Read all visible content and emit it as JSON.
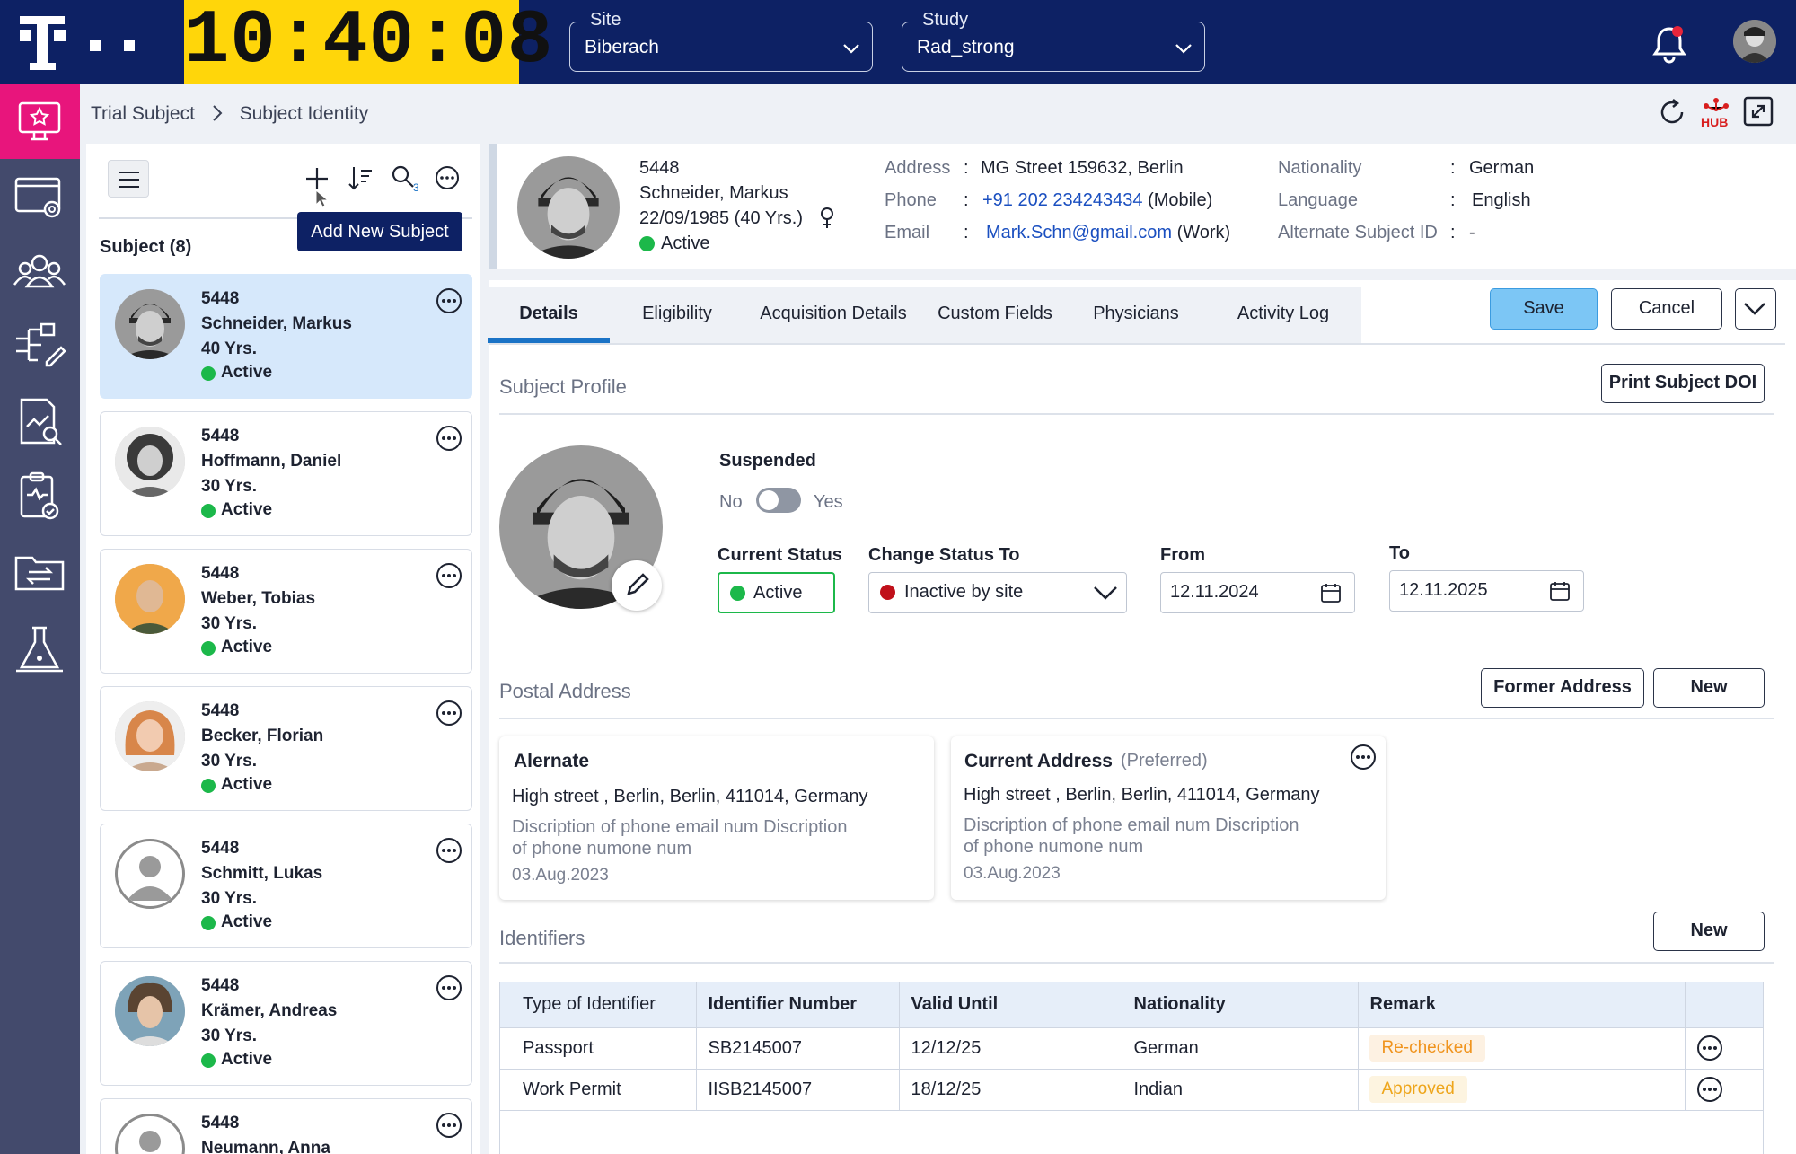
{
  "header": {
    "clock": "10:40:08",
    "site": {
      "label": "Site",
      "value": "Biberach"
    },
    "study": {
      "label": "Study",
      "value": "Rad_strong"
    }
  },
  "breadcrumb": [
    "Trial Subject",
    "Subject Identity"
  ],
  "toolbar": {
    "tooltip": "Add New Subject",
    "search_count": "3",
    "list_title": "Subject (8)"
  },
  "subjects": [
    {
      "id": "5448",
      "name": "Schneider, Markus",
      "age": "40 Yrs.",
      "status": "Active"
    },
    {
      "id": "5448",
      "name": "Hoffmann, Daniel",
      "age": "30 Yrs.",
      "status": "Active"
    },
    {
      "id": "5448",
      "name": "Weber, Tobias",
      "age": "30 Yrs.",
      "status": "Active"
    },
    {
      "id": "5448",
      "name": "Becker, Florian",
      "age": "30 Yrs.",
      "status": "Active"
    },
    {
      "id": "5448",
      "name": "Schmitt, Lukas",
      "age": "30 Yrs.",
      "status": "Active"
    },
    {
      "id": "5448",
      "name": "Krämer, Andreas",
      "age": "30 Yrs.",
      "status": "Active"
    },
    {
      "id": "5448",
      "name": "Neumann, Anna",
      "age": "",
      "status": ""
    }
  ],
  "profile": {
    "id": "5448",
    "name": "Schneider, Markus",
    "dob": "22/09/1985 (40 Yrs.)",
    "status": "Active",
    "address_label": "Address",
    "address": "MG Street 159632, Berlin",
    "phone_label": "Phone",
    "phone": "+91 202 234243434",
    "phone_type": "(Mobile)",
    "email_label": "Email",
    "email": "Mark.Schn@gmail.com",
    "email_type": "(Work)",
    "nationality_label": "Nationality",
    "nationality": "German",
    "language_label": "Language",
    "language": "English",
    "alt_id_label": "Alternate Subject ID",
    "alt_id": "-",
    "sep": ":"
  },
  "tabs": [
    "Details",
    "Eligibility",
    "Acquisition Details",
    "Custom Fields",
    "Physicians",
    "Activity Log"
  ],
  "actions": {
    "save": "Save",
    "cancel": "Cancel"
  },
  "subject_profile": {
    "title": "Subject Profile",
    "print": "Print Subject DOI",
    "suspended": "Suspended",
    "no": "No",
    "yes": "Yes",
    "current_status_label": "Current Status",
    "current_status": "Active",
    "change_status_label": "Change Status To",
    "change_status": "Inactive by site",
    "from_label": "From",
    "from": "12.11.2024",
    "to_label": "To",
    "to": "12.11.2025"
  },
  "postal": {
    "title": "Postal Address",
    "former": "Former Address",
    "new": "New",
    "alt": {
      "title": "Alernate",
      "line": "High street , Berlin, Berlin, 411014, Germany",
      "desc1": "Discription of phone email num Discription",
      "desc2": "of phone numone num",
      "date": "03.Aug.2023"
    },
    "cur": {
      "title": "Current Address",
      "pref": "(Preferred)",
      "line": "High street , Berlin, Berlin, 411014, Germany",
      "desc1": "Discription of phone email num Discription",
      "desc2": "of phone numone num",
      "date": "03.Aug.2023"
    }
  },
  "identifiers": {
    "title": "Identifiers",
    "new": "New",
    "headers": [
      "Type of Identifier",
      "Identifier Number",
      "Valid Until",
      "Nationality",
      "Remark"
    ],
    "rows": [
      {
        "type": "Passport",
        "number": "SB2145007",
        "valid": "12/12/25",
        "nationality": "German",
        "remark": "Re-checked"
      },
      {
        "type": "Work Permit",
        "number": "IISB2145007",
        "valid": "18/12/25",
        "nationality": "Indian",
        "remark": "Approved"
      }
    ]
  },
  "colors": {
    "header": "#0d2164",
    "clock": "#ffd60a",
    "accent": "#e8157c",
    "active": "#1cb84a",
    "tab_underline": "#1a73c6"
  }
}
